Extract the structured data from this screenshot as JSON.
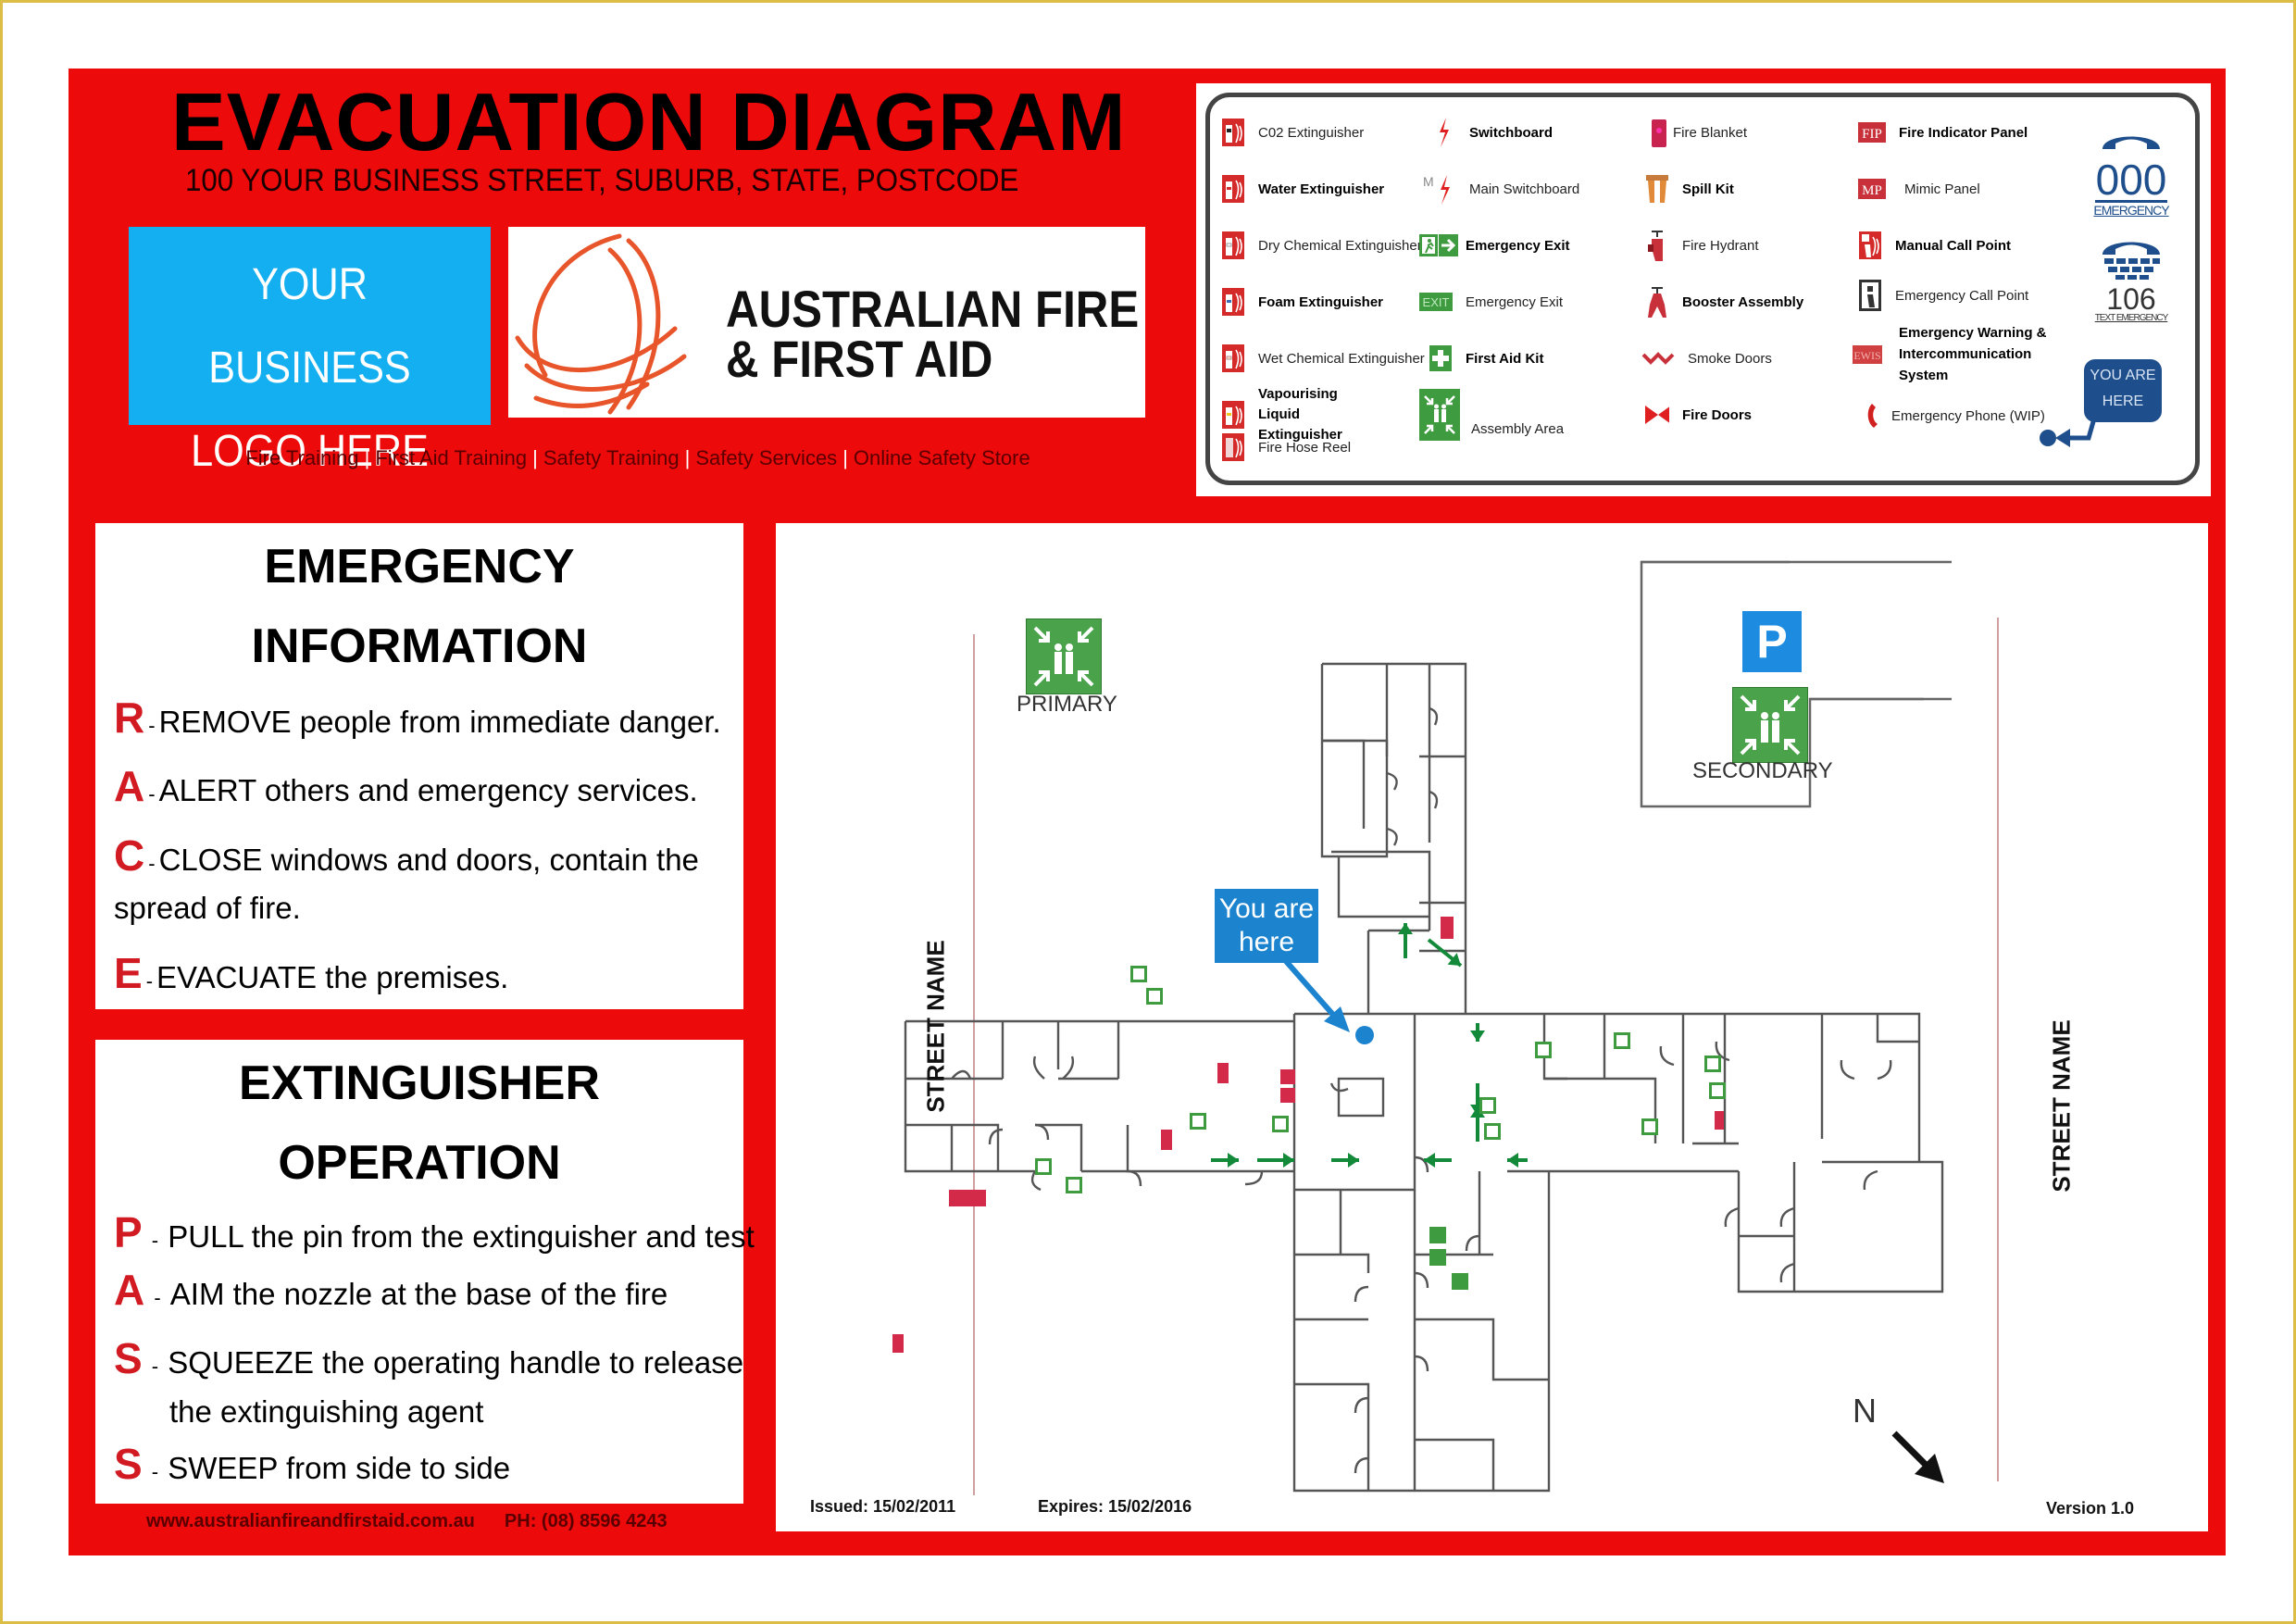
{
  "header": {
    "title": "EVACUATION DIAGRAM",
    "address": "100 YOUR BUSINESS STREET, SUBURB, STATE, POSTCODE"
  },
  "logo_placeholder": {
    "line1": "YOUR BUSINESS",
    "line2": "LOGO HERE"
  },
  "company": {
    "name_line1": "AUSTRALIAN FIRE",
    "name_line2": "& FIRST AID",
    "services": [
      "Fire Training",
      "First Aid Training",
      "Safety Training",
      "Safety Services",
      "Online Safety Store"
    ],
    "separator": "|",
    "website": "www.australianfireandfirstaid.com.au",
    "phone": "PH: (08) 8596 4243"
  },
  "legend": {
    "items": [
      {
        "label": "C02 Extinguisher",
        "icon": "co2-extinguisher-icon",
        "bold": false
      },
      {
        "label": "Water Extinguisher",
        "icon": "water-extinguisher-icon",
        "bold": true
      },
      {
        "label": "Dry Chemical Extinguisher",
        "icon": "dry-chemical-extinguisher-icon",
        "bold": false
      },
      {
        "label": "Foam Extinguisher",
        "icon": "foam-extinguisher-icon",
        "bold": true
      },
      {
        "label": "Wet Chemical Extinguisher",
        "icon": "wet-chemical-extinguisher-icon",
        "bold": false
      },
      {
        "label": "Vapourising Liquid Extinguisher",
        "icon": "vapourising-liquid-extinguisher-icon",
        "bold": true
      },
      {
        "label": "Fire Hose Reel",
        "icon": "fire-hose-reel-icon",
        "bold": false
      },
      {
        "label": "Switchboard",
        "icon": "switchboard-icon",
        "bold": true
      },
      {
        "label": "Main Switchboard",
        "icon": "main-switchboard-icon",
        "bold": false
      },
      {
        "label": "Emergency Exit",
        "icon": "emergency-exit-running-man-icon",
        "bold": true
      },
      {
        "label": "Emergency Exit",
        "icon": "exit-sign-icon",
        "bold": false,
        "icon_text": "EXIT"
      },
      {
        "label": "First Aid Kit",
        "icon": "first-aid-kit-icon",
        "bold": true
      },
      {
        "label": "Assembly Area",
        "icon": "assembly-area-icon",
        "bold": false
      },
      {
        "label": "Fire Blanket",
        "icon": "fire-blanket-icon",
        "bold": false
      },
      {
        "label": "Spill Kit",
        "icon": "spill-kit-icon",
        "bold": true
      },
      {
        "label": "Fire Hydrant",
        "icon": "fire-hydrant-icon",
        "bold": false
      },
      {
        "label": "Booster Assembly",
        "icon": "booster-assembly-icon",
        "bold": true
      },
      {
        "label": "Smoke Doors",
        "icon": "smoke-doors-icon",
        "bold": false
      },
      {
        "label": "Fire Doors",
        "icon": "fire-doors-icon",
        "bold": true
      },
      {
        "label": "Fire Indicator Panel",
        "icon": "fire-indicator-panel-icon",
        "bold": true,
        "icon_text": "FIP"
      },
      {
        "label": "Mimic Panel",
        "icon": "mimic-panel-icon",
        "bold": false,
        "icon_text": "MP"
      },
      {
        "label": "Manual Call Point",
        "icon": "manual-call-point-icon",
        "bold": true
      },
      {
        "label": "Emergency Call Point",
        "icon": "emergency-call-point-icon",
        "bold": false
      },
      {
        "label": "Emergency Warning & Intercommunication System",
        "icon": "ewis-icon",
        "bold": true,
        "icon_text": "EWIS"
      },
      {
        "label": "Emergency Phone (WIP)",
        "icon": "emergency-phone-icon",
        "bold": false
      }
    ],
    "emergency_number": "000",
    "emergency_label": "EMERGENCY",
    "text_emergency_number": "106",
    "text_emergency_label": "TEXT EMERGENCY",
    "you_are_here_line1": "YOU ARE",
    "you_are_here_line2": "HERE"
  },
  "emergency_info": {
    "title_line1": "EMERGENCY",
    "title_line2": "INFORMATION",
    "steps": [
      {
        "letter": "R",
        "keyword": "REMOVE",
        "text": "people from immediate danger."
      },
      {
        "letter": "A",
        "keyword": "ALERT",
        "text": "others and emergency services."
      },
      {
        "letter": "C",
        "keyword": "CLOSE",
        "text": "windows and doors, contain the",
        "continuation": "spread of fire."
      },
      {
        "letter": "E",
        "keyword": "EVACUATE",
        "text": "the premises."
      }
    ]
  },
  "extinguisher_operation": {
    "title_line1": "EXTINGUISHER",
    "title_line2": "OPERATION",
    "steps": [
      {
        "letter": "P",
        "keyword": "PULL",
        "text": "the pin from the extinguisher and test"
      },
      {
        "letter": "A",
        "keyword": "AIM",
        "text": "the nozzle at the base of the fire"
      },
      {
        "letter": "S",
        "keyword": "SQUEEZE",
        "text": "the operating handle to release",
        "continuation": "the extinguishing agent"
      },
      {
        "letter": "S",
        "keyword": "SWEEP",
        "text": "from side to side"
      }
    ]
  },
  "map": {
    "primary_assembly_label": "PRIMARY",
    "secondary_assembly_label": "SECONDARY",
    "parking_label": "P",
    "street_left": "STREET NAME",
    "street_right": "STREET NAME",
    "you_are_here_line1": "You are",
    "you_are_here_line2": "here",
    "north_label": "N",
    "issued": "Issued: 15/02/2011",
    "expires": "Expires: 15/02/2016",
    "version": "Version 1.0"
  },
  "colors": {
    "panel_red": "#ec0a0a",
    "logo_blue": "#13aff0",
    "exit_green": "#3f9b3f",
    "arrow_green": "#138a3a",
    "you_are_here_blue": "#1c83cf",
    "letter_red": "#d21a22",
    "legend_navy": "#1e4f8c"
  }
}
